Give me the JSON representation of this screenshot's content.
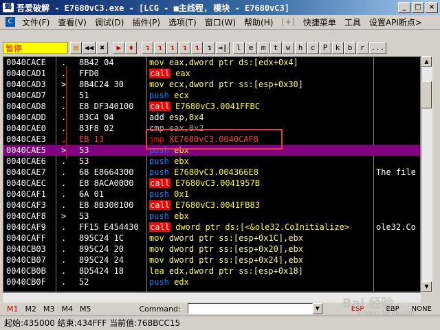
{
  "window": {
    "title": "吾爱破解 - E7680vC3.exe - [LCG - ■主线程, 模块 - E7680vC3]",
    "buttons": [
      "_",
      "□",
      "×"
    ]
  },
  "menubar": {
    "items": [
      "文件(F)",
      "查看(V)",
      "调试(D)",
      "插件(P)",
      "选项(T)",
      "窗口(W)",
      "帮助(H)",
      "[+]",
      "快捷菜单",
      "工具",
      "设置API断点>"
    ]
  },
  "toolbar": {
    "status": "暂停",
    "buttons": [
      "▶",
      "◀◀",
      "✖",
      "▶",
      "⏸",
      "↴",
      "↴",
      "↴",
      "↴",
      "↴",
      "↴",
      "→|",
      "l",
      "e",
      "m",
      "t",
      "w",
      "h",
      "c",
      "P",
      "k",
      "b",
      "r",
      "..."
    ]
  },
  "disasm": {
    "rows": [
      {
        "addr": "0040CACE",
        "mark": ".",
        "hex": "8B42 04",
        "op": "mov",
        "args": "eax,dword ptr ds:[edx+0x4]",
        "comment": ""
      },
      {
        "addr": "0040CAD1",
        "mark": ".",
        "hex": "FFD0",
        "op": "call",
        "args": "eax",
        "comment": ""
      },
      {
        "addr": "0040CAD3",
        "mark": ">",
        "hex": "8B4C24 30",
        "op": "mov",
        "args": "ecx,dword ptr ss:[esp+0x30]",
        "comment": ""
      },
      {
        "addr": "0040CAD7",
        "mark": ".",
        "hex": "51",
        "op": "push",
        "args": "ecx",
        "comment": ""
      },
      {
        "addr": "0040CAD8",
        "mark": ".",
        "hex": "E8 DF340100",
        "op": "call",
        "args": "E7680vC3.0041FFBC",
        "comment": ""
      },
      {
        "addr": "0040CADD",
        "mark": ".",
        "hex": "83C4 04",
        "op": "add",
        "args": "esp,0x4",
        "comment": ""
      },
      {
        "addr": "0040CAE0",
        "mark": ".",
        "hex": "83F8 02",
        "op": "cmp",
        "args": "eax,0x2",
        "comment": ""
      },
      {
        "addr": "0040CAE3",
        "mark": "⌄",
        "hex": "EB 13",
        "op": "jmp",
        "args": "XE7680vC3.0040CAF8",
        "comment": ""
      },
      {
        "addr": "0040CAE5",
        "mark": ">",
        "hex": "53",
        "op": "push",
        "args": "ebx",
        "comment": ""
      },
      {
        "addr": "0040CAE6",
        "mark": ".",
        "hex": "53",
        "op": "push",
        "args": "ebx",
        "comment": ""
      },
      {
        "addr": "0040CAE7",
        "mark": ".",
        "hex": "68 E8664300",
        "op": "push",
        "args": "E7680vC3.004366E8",
        "comment": "The file"
      },
      {
        "addr": "0040CAEC",
        "mark": ".",
        "hex": "E8 8ACA0000",
        "op": "call",
        "args": "E7680vC3.0041957B",
        "comment": ""
      },
      {
        "addr": "0040CAF1",
        "mark": ".",
        "hex": "6A 01",
        "op": "push",
        "args": "0x1",
        "comment": ""
      },
      {
        "addr": "0040CAF3",
        "mark": ".",
        "hex": "E8 8B300100",
        "op": "call",
        "args": "E7680vC3.0041FB83",
        "comment": ""
      },
      {
        "addr": "0040CAF8",
        "mark": ">",
        "hex": "53",
        "op": "push",
        "args": "ebx",
        "comment": ""
      },
      {
        "addr": "0040CAF9",
        "mark": ".",
        "hex": "FF15 E454430",
        "op": "call",
        "args": "dword ptr ds:[<&ole32.CoInitialize>",
        "comment": "ole32.Co"
      },
      {
        "addr": "0040CAFF",
        "mark": ".",
        "hex": "895C24 1C",
        "op": "mov",
        "args": "dword ptr ss:[esp+0x1C],ebx",
        "comment": ""
      },
      {
        "addr": "0040CB03",
        "mark": ".",
        "hex": "895C24 20",
        "op": "mov",
        "args": "dword ptr ss:[esp+0x20],ebx",
        "comment": ""
      },
      {
        "addr": "0040CB07",
        "mark": ".",
        "hex": "895C24 24",
        "op": "mov",
        "args": "dword ptr ss:[esp+0x24],ebx",
        "comment": ""
      },
      {
        "addr": "0040CB0B",
        "mark": ".",
        "hex": "8D5424 18",
        "op": "lea",
        "args": "edx,dword ptr ss:[esp+0x18]",
        "comment": ""
      },
      {
        "addr": "0040CB0F",
        "mark": ".",
        "hex": "52",
        "op": "push",
        "args": "edx",
        "comment": ""
      }
    ],
    "selected_index": 8,
    "highlighted_index": 7
  },
  "commandbar": {
    "tabs": [
      "M1",
      "M2",
      "M3",
      "M4",
      "M5"
    ],
    "label": "Command:",
    "registers": [
      "ESP",
      "EBP",
      "NONE"
    ]
  },
  "statusbar": {
    "text": "起始:435000  结束:434FFF  当前值:768BCC15"
  },
  "watermark": {
    "text": "Bai 经验",
    "sub": "jingyan.baidu.com"
  }
}
